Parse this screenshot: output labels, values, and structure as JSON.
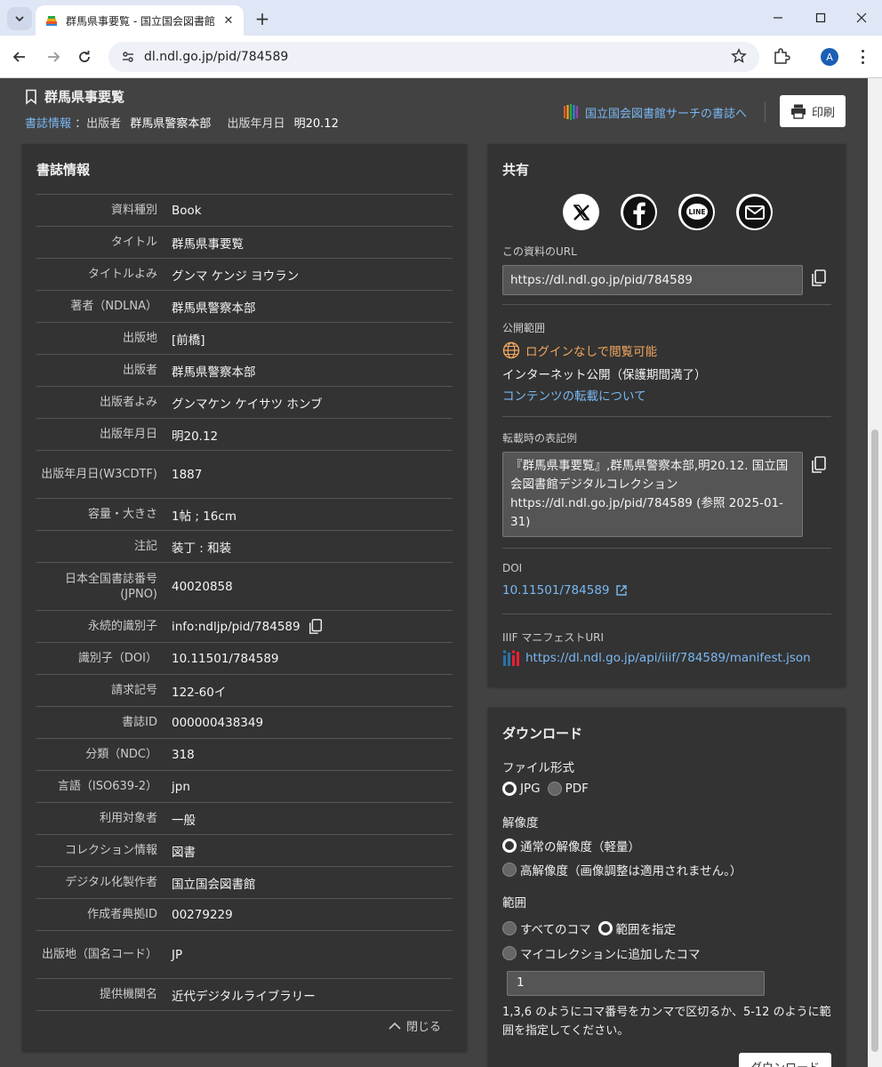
{
  "browser": {
    "tab_title": "群馬県事要覧 - 国立国会図書館",
    "url": "dl.ndl.go.jp/pid/784589",
    "avatar_letter": "A"
  },
  "header": {
    "title": "群馬県事要覧",
    "biblio_link": "書誌情報",
    "publisher_label": "：出版者",
    "publisher": "群馬県警察本部",
    "date_label": "出版年月日",
    "date": "明20.12",
    "ndl_search_link": "国立国会図書館サーチの書誌へ",
    "print_label": "印刷"
  },
  "biblio": {
    "heading": "書誌情報",
    "rows": [
      {
        "key": "資料種別",
        "value": "Book"
      },
      {
        "key": "タイトル",
        "value": "群馬県事要覧"
      },
      {
        "key": "タイトルよみ",
        "value": "グンマ ケンジ ヨウラン"
      },
      {
        "key": "著者（NDLNA）",
        "value": "群馬県警察本部"
      },
      {
        "key": "出版地",
        "value": "[前橋]"
      },
      {
        "key": "出版者",
        "value": "群馬県警察本部"
      },
      {
        "key": "出版者よみ",
        "value": "グンマケン ケイサツ ホンブ"
      },
      {
        "key": "出版年月日",
        "value": "明20.12"
      },
      {
        "key": "出版年月日(W3CDTF)",
        "value": "1887"
      },
      {
        "key": "容量・大きさ",
        "value": "1帖 ; 16cm"
      },
      {
        "key": "注記",
        "value": "装丁 : 和装"
      },
      {
        "key": "日本全国書誌番号(JPNO)",
        "value": "40020858"
      },
      {
        "key": "永続的識別子",
        "value": "info:ndljp/pid/784589"
      },
      {
        "key": "識別子（DOI）",
        "value": "10.11501/784589"
      },
      {
        "key": "請求記号",
        "value": "122-60イ"
      },
      {
        "key": "書誌ID",
        "value": "000000438349"
      },
      {
        "key": "分類（NDC）",
        "value": "318"
      },
      {
        "key": "言語（ISO639-2）",
        "value": "jpn"
      },
      {
        "key": "利用対象者",
        "value": "一般"
      },
      {
        "key": "コレクション情報",
        "value": "図書"
      },
      {
        "key": "デジタル化製作者",
        "value": "国立国会図書館"
      },
      {
        "key": "作成者典拠ID",
        "value": "00279229"
      },
      {
        "key": "出版地（国名コード）",
        "value": "JP"
      },
      {
        "key": "提供機関名",
        "value": "近代デジタルライブラリー"
      }
    ],
    "close_label": "閉じる"
  },
  "share": {
    "heading": "共有",
    "url_label": "この資料のURL",
    "url": "https://dl.ndl.go.jp/pid/784589",
    "scope_label": "公開範囲",
    "scope_status": "ログインなしで閲覧可能",
    "scope_detail": "インターネット公開（保護期間満了）",
    "reuse_link": "コンテンツの転載について",
    "citation_label": "転載時の表記例",
    "citation": "『群馬県事要覧』,群馬県警察本部,明20.12. 国立国会図書館デジタルコレクション https://dl.ndl.go.jp/pid/784589 (参照 2025-01-31)",
    "doi_label": "DOI",
    "doi": "10.11501/784589",
    "iiif_label": "IIIF マニフェストURI",
    "iiif_url": "https://dl.ndl.go.jp/api/iiif/784589/manifest.json"
  },
  "download": {
    "heading": "ダウンロード",
    "format_label": "ファイル形式",
    "format_jpg": "JPG",
    "format_pdf": "PDF",
    "resolution_label": "解像度",
    "res_normal": "通常の解像度（軽量）",
    "res_high": "高解像度（画像調整は適用されません。）",
    "range_label": "範囲",
    "range_all": "すべてのコマ",
    "range_specify": "範囲を指定",
    "range_mycollection": "マイコレクションに追加したコマ",
    "range_value": "1",
    "help_text": "1,3,6 のようにコマ番号をカンマで区切るか、5-12 のように範囲を指定してください。",
    "button_label": "ダウンロード"
  }
}
